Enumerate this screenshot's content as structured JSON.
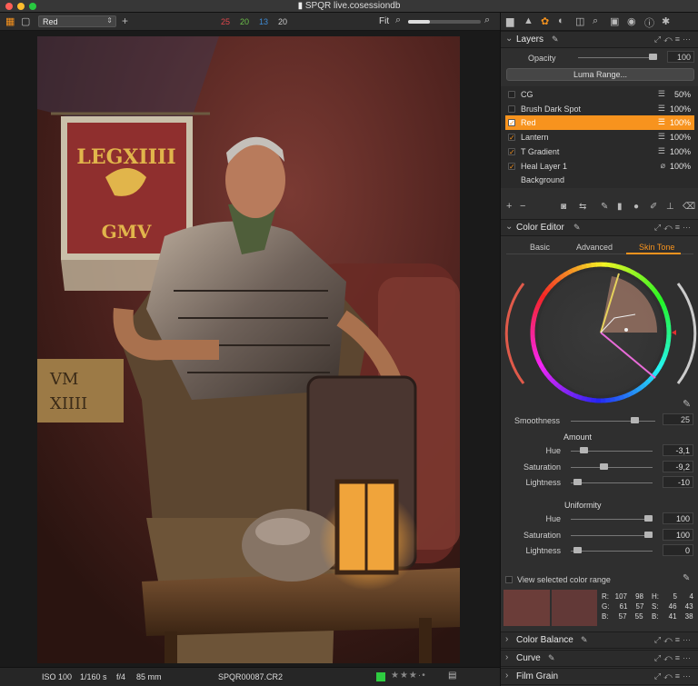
{
  "window": {
    "title": "SPQR live.cosessiondb"
  },
  "toolbar": {
    "layer_select": "Red",
    "counts": [
      "25",
      "20",
      "13",
      "20"
    ],
    "count_colors": [
      "#e0474c",
      "#6cc04a",
      "#3f8cd6",
      "#cccccc"
    ],
    "fit_label": "Fit",
    "zoom_level": 0.3
  },
  "status": {
    "iso": "ISO 100",
    "shutter": "1/160 s",
    "aperture": "f/4",
    "focal": "85 mm",
    "filename": "SPQR00087.CR2",
    "color_tag": "#2ecc40",
    "rating_stars": 0
  },
  "photo": {
    "banner_line1": "LEGXIIII",
    "banner_line2": "GMV",
    "sign_line1": "VM",
    "sign_line2": "XIIII"
  },
  "layers": {
    "title": "Layers",
    "opacity_label": "Opacity",
    "opacity_value": "100",
    "luma_button": "Luma Range...",
    "items": [
      {
        "name": "CG",
        "percent": "50%",
        "checked": false,
        "selected": false,
        "icon": "sliders-icon"
      },
      {
        "name": "Brush Dark Spot",
        "percent": "100%",
        "checked": false,
        "selected": false,
        "icon": "sliders-icon"
      },
      {
        "name": "Red",
        "percent": "100%",
        "checked": true,
        "selected": true,
        "icon": "sliders-icon"
      },
      {
        "name": "Lantern",
        "percent": "100%",
        "checked": true,
        "selected": false,
        "icon": "sliders-icon"
      },
      {
        "name": "T Gradient",
        "percent": "100%",
        "checked": true,
        "selected": false,
        "icon": "sliders-icon"
      },
      {
        "name": "Heal Layer 1",
        "percent": "100%",
        "checked": true,
        "selected": false,
        "icon": "bandage-icon"
      },
      {
        "name": "Background",
        "percent": "",
        "checked": false,
        "selected": false,
        "icon": ""
      }
    ],
    "add_label": "+",
    "remove_label": "−"
  },
  "color_editor": {
    "title": "Color Editor",
    "tabs": [
      "Basic",
      "Advanced",
      "Skin Tone"
    ],
    "active_tab": "Skin Tone",
    "smoothness_label": "Smoothness",
    "smoothness_value": "25",
    "amount_heading": "Amount",
    "amount": [
      {
        "label": "Hue",
        "value": "-3,1",
        "pos": 0.12
      },
      {
        "label": "Saturation",
        "value": "-9,2",
        "pos": 0.38
      },
      {
        "label": "Lightness",
        "value": "-10",
        "pos": 0.03
      }
    ],
    "uniformity_heading": "Uniformity",
    "uniformity": [
      {
        "label": "Hue",
        "value": "100",
        "pos": 0.97
      },
      {
        "label": "Saturation",
        "value": "100",
        "pos": 0.97
      },
      {
        "label": "Lightness",
        "value": "0",
        "pos": 0.03
      }
    ],
    "view_range_label": "View selected color range",
    "readout": {
      "r": [
        "R:",
        "107",
        "98"
      ],
      "g": [
        "G:",
        "61",
        "57"
      ],
      "b": [
        "B:",
        "57",
        "55"
      ],
      "h": [
        "H:",
        "5",
        "4"
      ],
      "s": [
        "S:",
        "46",
        "43"
      ],
      "l": [
        "B:",
        "41",
        "38"
      ]
    },
    "swatch_before": "#6b3d39",
    "swatch_after": "#623937"
  },
  "collapsed": {
    "color_balance": "Color Balance",
    "curve": "Curve",
    "film_grain": "Film Grain"
  }
}
